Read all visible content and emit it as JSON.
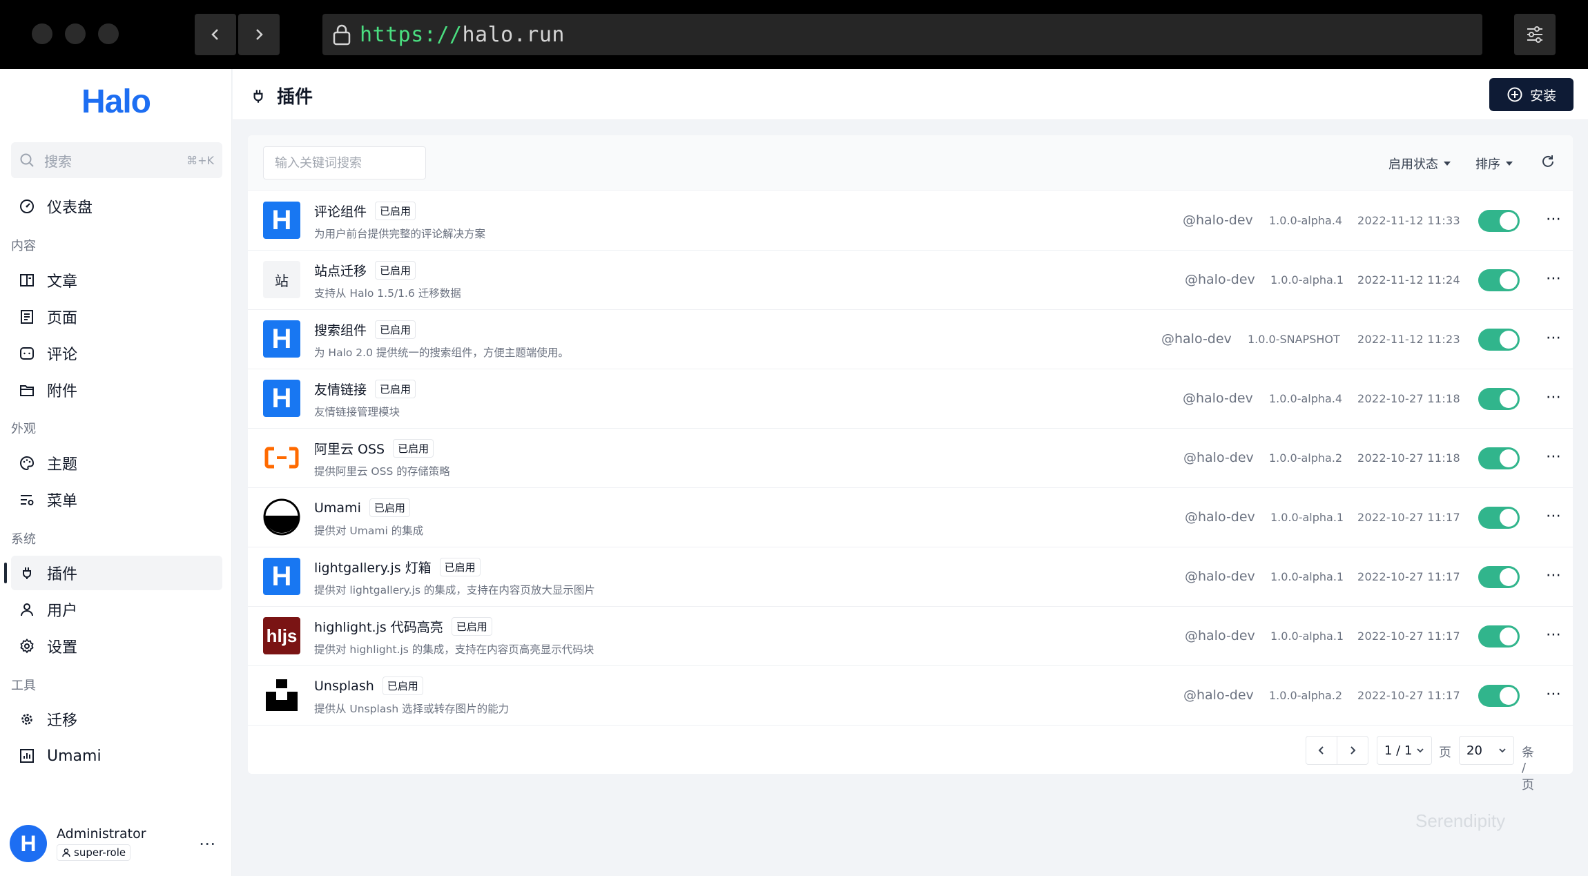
{
  "browser": {
    "url_scheme": "https://",
    "url_host": "halo.run"
  },
  "sidebar": {
    "logo": "Halo",
    "search_placeholder": "搜索",
    "search_shortcut": "⌘+K",
    "dashboard": "仪表盘",
    "groups": {
      "content": "内容",
      "appearance": "外观",
      "system": "系统",
      "tools": "工具"
    },
    "items": {
      "posts": "文章",
      "pages": "页面",
      "comments": "评论",
      "attachments": "附件",
      "themes": "主题",
      "menus": "菜单",
      "plugins": "插件",
      "users": "用户",
      "settings": "设置",
      "migration": "迁移",
      "umami": "Umami"
    },
    "user": {
      "avatar_letter": "H",
      "name": "Administrator",
      "role": "super-role",
      "more": "⋯"
    }
  },
  "header": {
    "title": "插件",
    "install_label": "安装"
  },
  "toolbar": {
    "keyword_placeholder": "输入关键词搜索",
    "status_filter": "启用状态",
    "sort": "排序"
  },
  "plugins": [
    {
      "logo": "H",
      "name": "评论组件",
      "status": "已启用",
      "desc": "为用户前台提供完整的评论解决方案",
      "author": "@halo-dev",
      "version": "1.0.0-alpha.4",
      "date": "2022-11-12 11:33",
      "enabled": true
    },
    {
      "logo": "站",
      "name": "站点迁移",
      "status": "已启用",
      "desc": "支持从 Halo 1.5/1.6 迁移数据",
      "author": "@halo-dev",
      "version": "1.0.0-alpha.1",
      "date": "2022-11-12 11:24",
      "enabled": true
    },
    {
      "logo": "H",
      "name": "搜索组件",
      "status": "已启用",
      "desc": "为 Halo 2.0 提供统一的搜索组件，方便主题端使用。",
      "author": "@halo-dev",
      "version": "1.0.0-SNAPSHOT",
      "date": "2022-11-12 11:23",
      "enabled": true
    },
    {
      "logo": "H",
      "name": "友情链接",
      "status": "已启用",
      "desc": "友情链接管理模块",
      "author": "@halo-dev",
      "version": "1.0.0-alpha.4",
      "date": "2022-10-27 11:18",
      "enabled": true
    },
    {
      "logo": "",
      "name": "阿里云 OSS",
      "status": "已启用",
      "desc": "提供阿里云 OSS 的存储策略",
      "author": "@halo-dev",
      "version": "1.0.0-alpha.2",
      "date": "2022-10-27 11:18",
      "enabled": true
    },
    {
      "logo": "",
      "name": "Umami",
      "status": "已启用",
      "desc": "提供对 Umami 的集成",
      "author": "@halo-dev",
      "version": "1.0.0-alpha.1",
      "date": "2022-10-27 11:17",
      "enabled": true
    },
    {
      "logo": "H",
      "name": "lightgallery.js 灯箱",
      "status": "已启用",
      "desc": "提供对 lightgallery.js 的集成，支持在内容页放大显示图片",
      "author": "@halo-dev",
      "version": "1.0.0-alpha.1",
      "date": "2022-10-27 11:17",
      "enabled": true
    },
    {
      "logo": "hljs",
      "name": "highlight.js 代码高亮",
      "status": "已启用",
      "desc": "提供对 highlight.js 的集成，支持在内容页高亮显示代码块",
      "author": "@halo-dev",
      "version": "1.0.0-alpha.1",
      "date": "2022-10-27 11:17",
      "enabled": true
    },
    {
      "logo": "",
      "name": "Unsplash",
      "status": "已启用",
      "desc": "提供从 Unsplash 选择或转存图片的能力",
      "author": "@halo-dev",
      "version": "1.0.0-alpha.2",
      "date": "2022-10-27 11:17",
      "enabled": true
    }
  ],
  "pagination": {
    "page": "1 / 1",
    "page_unit": "页",
    "size": "20",
    "size_unit": "条 / 页"
  },
  "watermark": "Serendipity",
  "colors": {
    "brand": "#1d6ef2",
    "toggle_on": "#31b58c",
    "install_button": "#0e1b35"
  }
}
